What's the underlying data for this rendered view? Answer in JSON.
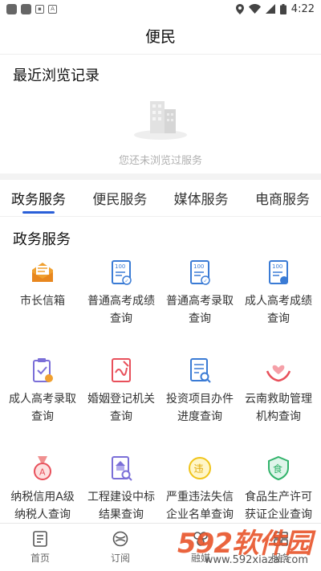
{
  "status_bar": {
    "time": "4:22"
  },
  "page": {
    "title": "便民"
  },
  "recent": {
    "title": "最近浏览记录",
    "empty_text": "您还未浏览过服务"
  },
  "tabs": [
    {
      "label": "政务服务",
      "active": true
    },
    {
      "label": "便民服务",
      "active": false
    },
    {
      "label": "媒体服务",
      "active": false
    },
    {
      "label": "电商服务",
      "active": false
    }
  ],
  "grid": {
    "title": "政务服务",
    "items": [
      {
        "label": "市长信箱",
        "icon": "mailbox-icon"
      },
      {
        "label": "普通高考成绩查询",
        "icon": "score-report-icon"
      },
      {
        "label": "普通高考录取查询",
        "icon": "admission-report-icon"
      },
      {
        "label": "成人高考成绩查询",
        "icon": "adult-score-icon"
      },
      {
        "label": "成人高考录取查询",
        "icon": "clipboard-check-icon"
      },
      {
        "label": "婚姻登记机关查询",
        "icon": "marriage-certificate-icon"
      },
      {
        "label": "投资项目办件进度查询",
        "icon": "document-search-icon"
      },
      {
        "label": "云南救助管理机构查询",
        "icon": "helping-hands-icon"
      },
      {
        "label": "纳税信用A级纳税人查询",
        "icon": "medal-a-icon"
      },
      {
        "label": "工程建设中标结果查询",
        "icon": "construction-doc-icon"
      },
      {
        "label": "严重违法失信企业名单查询",
        "icon": "violation-badge-icon"
      },
      {
        "label": "食品生产许可获证企业查询",
        "icon": "food-shield-icon"
      }
    ]
  },
  "bottom_nav": [
    {
      "label": "首页",
      "icon": "home-doc-icon"
    },
    {
      "label": "订阅",
      "icon": "subscribe-icon"
    },
    {
      "label": "融媒",
      "icon": "media-icon"
    },
    {
      "label": "服务",
      "icon": "service-icon"
    }
  ],
  "watermark": {
    "logo": "592软件园",
    "url": "www.592xiazai.com"
  }
}
